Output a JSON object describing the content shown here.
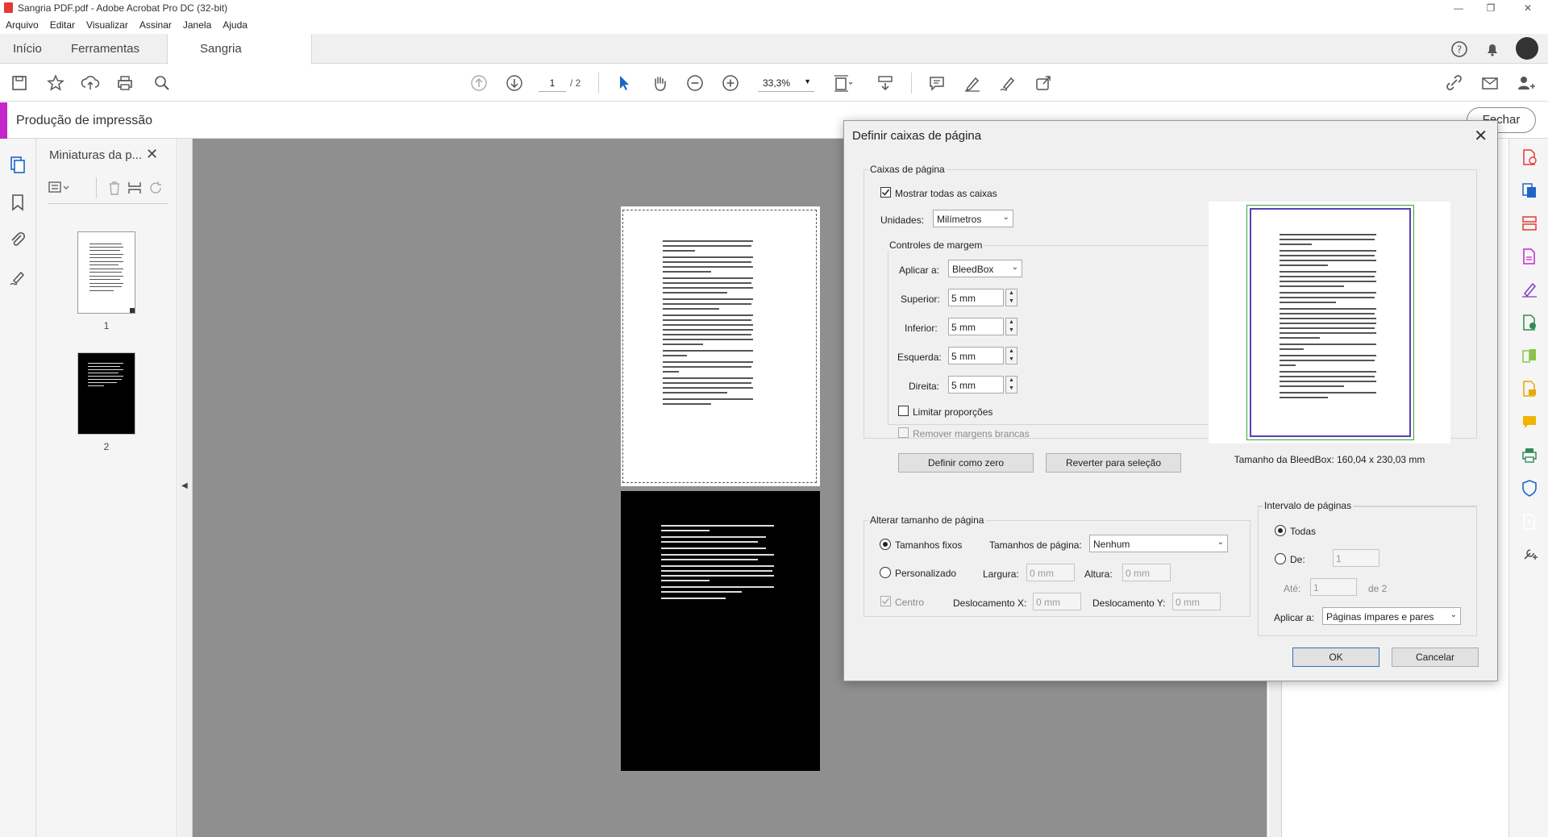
{
  "window": {
    "title": "Sangria PDF.pdf - Adobe Acrobat Pro DC (32-bit)",
    "controls": [
      "—",
      "❐",
      "✕"
    ]
  },
  "menu": [
    "Arquivo",
    "Editar",
    "Visualizar",
    "Assinar",
    "Janela",
    "Ajuda"
  ],
  "tabs": {
    "home": "Início",
    "tools": "Ferramentas",
    "doc": "Sangria PDF.pdf"
  },
  "toolbar": {
    "page_current": "1",
    "page_total": "/ 2",
    "zoom": "33,3%"
  },
  "production": {
    "title": "Produção de impressão",
    "close": "Fechar"
  },
  "thumbnails": {
    "title": "Miniaturas da p...",
    "pages": [
      "1",
      "2"
    ]
  },
  "dialog": {
    "title": "Definir caixas de página",
    "page_boxes": {
      "title": "Caixas de página",
      "show_all": "Mostrar todas as caixas",
      "units_label": "Unidades:",
      "units_value": "Milímetros",
      "margin_controls": "Controles de margem",
      "apply_label": "Aplicar a:",
      "apply_value": "BleedBox",
      "top_label": "Superior:",
      "top_value": "5 mm",
      "bottom_label": "Inferior:",
      "bottom_value": "5 mm",
      "left_label": "Esquerda:",
      "left_value": "5 mm",
      "right_label": "Direita:",
      "right_value": "5 mm",
      "constrain": "Limitar proporções",
      "remove_white": "Remover margens brancas",
      "set_zero": "Definir como zero",
      "revert": "Reverter para seleção",
      "bleed_size": "Tamanho da BleedBox: 160,04 x 230,03 mm"
    },
    "resize": {
      "title": "Alterar tamanho de página",
      "fixed": "Tamanhos fixos",
      "sizes_label": "Tamanhos de página:",
      "sizes_value": "Nenhum",
      "custom": "Personalizado",
      "width_label": "Largura:",
      "width_value": "0 mm",
      "height_label": "Altura:",
      "height_value": "0 mm",
      "center": "Centro",
      "offx_label": "Deslocamento X:",
      "offx_value": "0 mm",
      "offy_label": "Deslocamento Y:",
      "offy_value": "0 mm"
    },
    "range": {
      "title": "Intervalo de páginas",
      "all": "Todas",
      "from": "De:",
      "from_value": "1",
      "to": "Até:",
      "to_value": "1",
      "of": "de 2",
      "apply_label": "Aplicar a:",
      "apply_value": "Páginas ímpares e pares"
    },
    "ok": "OK",
    "cancel": "Cancelar"
  }
}
